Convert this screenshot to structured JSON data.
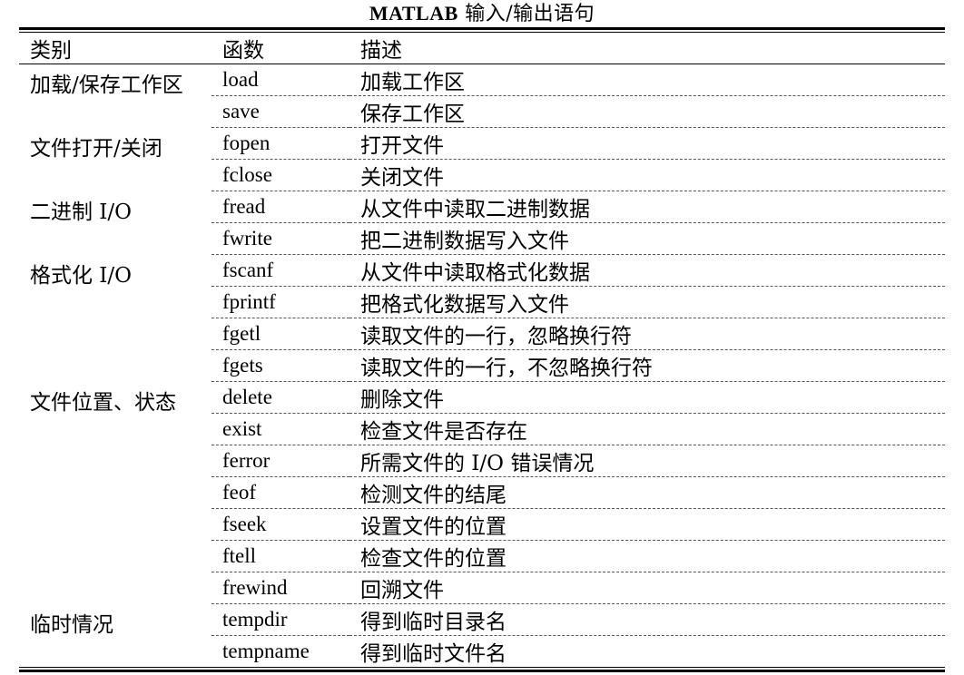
{
  "caption": {
    "bold": "MATLAB",
    "rest": " 输入/输出语句"
  },
  "headers": {
    "category": "类别",
    "function": "函数",
    "description": "描述"
  },
  "groups": [
    {
      "category": "加载/保存工作区",
      "rows": [
        {
          "fn": "load",
          "desc": "加载工作区"
        },
        {
          "fn": "save",
          "desc": "保存工作区"
        }
      ]
    },
    {
      "category": "文件打开/关闭",
      "rows": [
        {
          "fn": "fopen",
          "desc": "打开文件"
        },
        {
          "fn": "fclose",
          "desc": "关闭文件"
        }
      ]
    },
    {
      "category": "二进制 I/O",
      "rows": [
        {
          "fn": "fread",
          "desc": "从文件中读取二进制数据"
        },
        {
          "fn": "fwrite",
          "desc": "把二进制数据写入文件"
        }
      ]
    },
    {
      "category": "格式化 I/O",
      "rows": [
        {
          "fn": "fscanf",
          "desc": "从文件中读取格式化数据"
        },
        {
          "fn": "fprintf",
          "desc": "把格式化数据写入文件"
        },
        {
          "fn": "fgetl",
          "desc": "读取文件的一行，忽略换行符"
        },
        {
          "fn": "fgets",
          "desc": "读取文件的一行，不忽略换行符"
        }
      ]
    },
    {
      "category": "文件位置、状态",
      "rows": [
        {
          "fn": "delete",
          "desc": "删除文件"
        },
        {
          "fn": "exist",
          "desc": "检查文件是否存在"
        },
        {
          "fn": "ferror",
          "desc": "所需文件的 I/O 错误情况"
        },
        {
          "fn": "feof",
          "desc": "检测文件的结尾"
        },
        {
          "fn": "fseek",
          "desc": "设置文件的位置"
        },
        {
          "fn": "ftell",
          "desc": "检查文件的位置"
        },
        {
          "fn": "frewind",
          "desc": "回溯文件"
        }
      ]
    },
    {
      "category": "临时情况",
      "rows": [
        {
          "fn": "tempdir",
          "desc": "得到临时目录名"
        },
        {
          "fn": "tempname",
          "desc": "得到临时文件名"
        }
      ]
    }
  ]
}
